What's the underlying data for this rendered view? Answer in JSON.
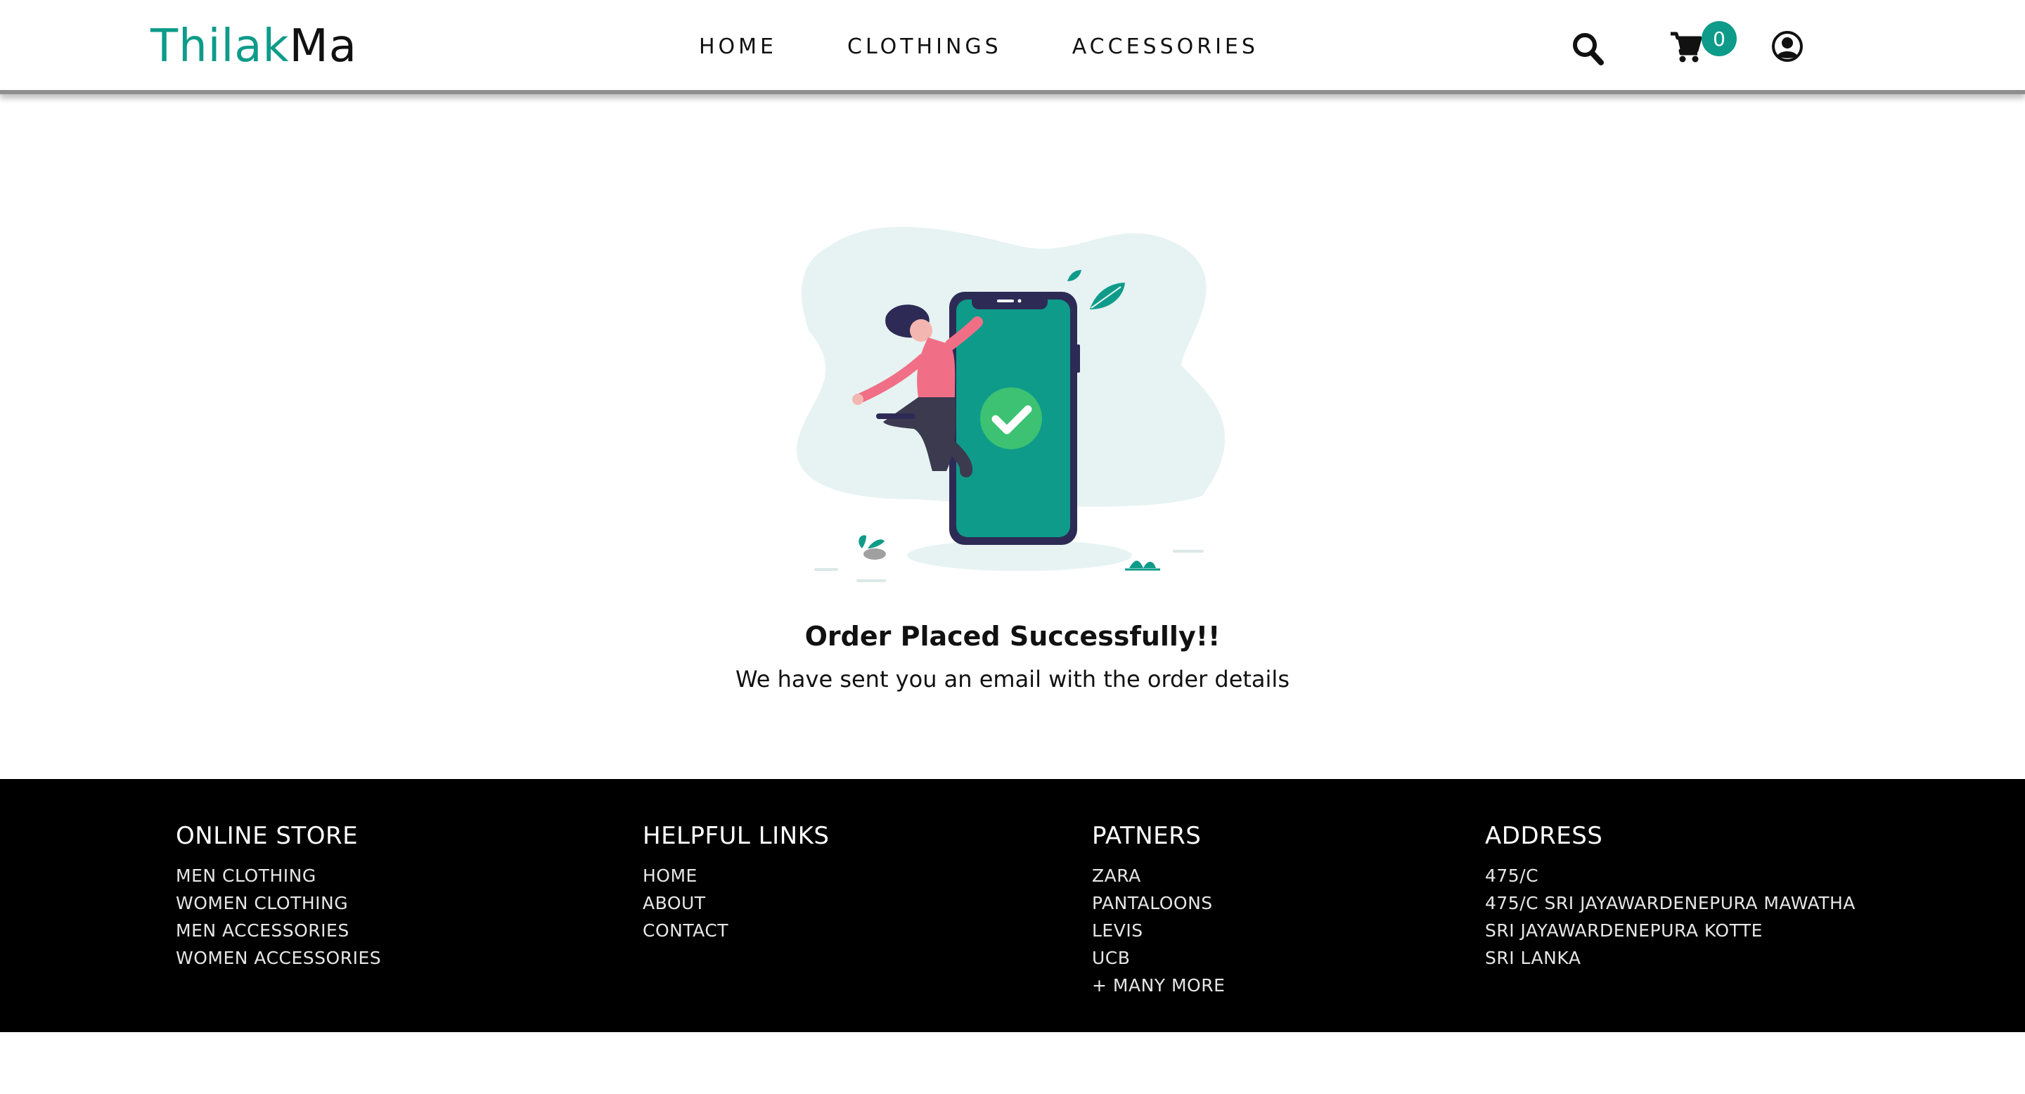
{
  "brand": {
    "part1": "Thilak",
    "part2": "Ma"
  },
  "nav": {
    "links": [
      "HOME",
      "CLOTHINGS",
      "ACCESSORIES"
    ],
    "cart_count": "0"
  },
  "icons": {
    "search": "search-icon",
    "cart": "cart-icon",
    "user": "user-circle-icon"
  },
  "colors": {
    "accent": "#0e9b8a",
    "success_green": "#3cc272",
    "footer_bg": "#000000"
  },
  "main": {
    "title": "Order Placed Successfully!!",
    "subtitle": "We have sent you an email with the order details"
  },
  "footer": {
    "online_store": {
      "heading": "ONLINE STORE",
      "items": [
        "MEN CLOTHING",
        "WOMEN CLOTHING",
        "MEN ACCESSORIES",
        "WOMEN ACCESSORIES"
      ]
    },
    "helpful_links": {
      "heading": "HELPFUL LINKS",
      "items": [
        "HOME",
        "ABOUT",
        "CONTACT"
      ]
    },
    "partners": {
      "heading": "PATNERS",
      "items": [
        "ZARA",
        "PANTALOONS",
        "LEVIS",
        "UCB",
        "+ MANY MORE"
      ]
    },
    "address": {
      "heading": "ADDRESS",
      "items": [
        "475/C",
        "475/C SRI JAYAWARDENEPURA MAWATHA",
        "SRI JAYAWARDENEPURA KOTTE",
        "SRI LANKA"
      ]
    }
  }
}
